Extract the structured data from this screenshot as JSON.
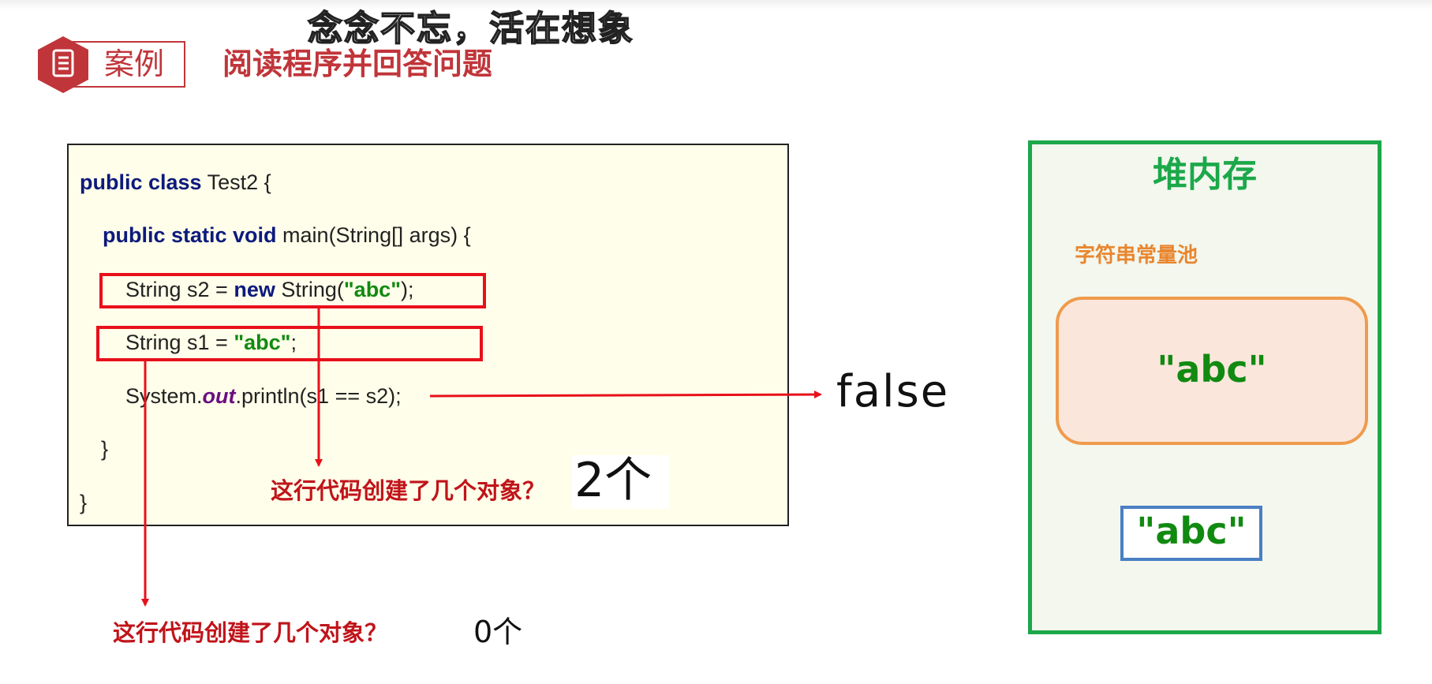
{
  "subtitle": "念念不忘，活在想象",
  "header": {
    "badge_label": "案例",
    "title": "阅读程序并回答问题"
  },
  "code": {
    "line1_kw": "public class",
    "line1_rest": " Test2 {",
    "line2_kw": "public static void",
    "line2_rest": " main(String[] args) {",
    "line3_pre": "String s2 = ",
    "line3_kw": "new",
    "line3_mid": " String(",
    "line3_str": "\"abc\"",
    "line3_post": ");",
    "line4_pre": "String s1 = ",
    "line4_str": "\"abc\"",
    "line4_post": ";",
    "line5_pre": "System.",
    "line5_ital": "out",
    "line5_post": ".println(s1 == s2);",
    "line6": "}",
    "line7": "}"
  },
  "annotations": {
    "question_s2": "这行代码创建了几个对象？",
    "answer_s2": "2个",
    "question_s1": "这行代码创建了几个对象？",
    "answer_s1": "0个",
    "result": "false"
  },
  "heap": {
    "title": "堆内存",
    "pool_title": "字符串常量池",
    "pool_value": "\"abc\"",
    "heap_object_value": "\"abc\""
  },
  "colors": {
    "accent_red": "#c0353a",
    "arrow_red": "#e8101a",
    "keyword_blue": "#0d1a7d",
    "string_green": "#118a11",
    "heap_green": "#1ca84a",
    "pool_orange": "#ef9b4d",
    "object_blue": "#4a7fc2"
  },
  "icons": {
    "badge_icon": "document-icon"
  }
}
